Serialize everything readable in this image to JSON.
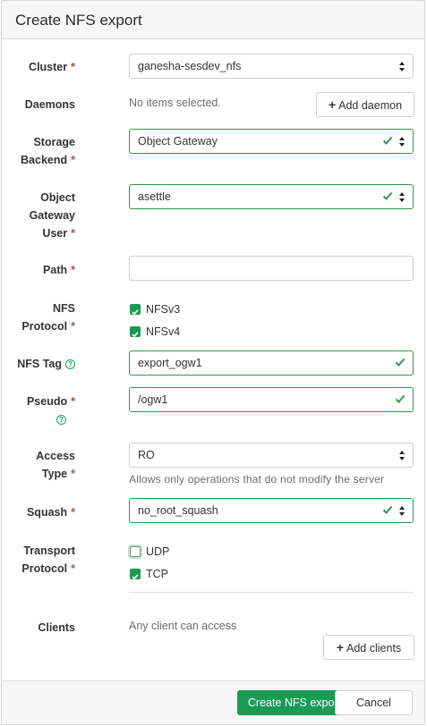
{
  "dialog": {
    "title": "Create NFS export"
  },
  "colors": {
    "primary": "#1a9b55",
    "valid_border": "#2c9a4f",
    "required": "#b94a48"
  },
  "form": {
    "cluster": {
      "label": "Cluster",
      "required_mark": "*",
      "value": "ganesha-sesdev_nfs"
    },
    "daemons": {
      "label": "Daemons",
      "empty_text": "No items selected.",
      "add_button": "Add daemon"
    },
    "storage_backend": {
      "label_line1": "Storage",
      "label_line2": "Backend",
      "required_mark": "*",
      "value": "Object Gateway"
    },
    "rgw_user": {
      "label_line1": "Object",
      "label_line2": "Gateway",
      "label_line3": "User",
      "required_mark": "*",
      "value": "asettle"
    },
    "path": {
      "label": "Path",
      "required_mark": "*",
      "value": ""
    },
    "nfs_protocol": {
      "label_line1": "NFS",
      "label_line2": "Protocol",
      "required_mark": "*",
      "options": [
        {
          "label": "NFSv3",
          "checked": true
        },
        {
          "label": "NFSv4",
          "checked": true
        }
      ]
    },
    "nfs_tag": {
      "label": "NFS Tag",
      "help_icon": "question-circle-icon",
      "help_glyph": "?",
      "value": "export_ogw1"
    },
    "pseudo": {
      "label": "Pseudo",
      "required_mark": "*",
      "help_icon": "question-circle-icon",
      "help_glyph": "?",
      "value": "/ogw1"
    },
    "access_type": {
      "label_line1": "Access",
      "label_line2": "Type",
      "required_mark": "*",
      "value": "RO",
      "hint": "Allows only operations that do not modify the server"
    },
    "squash": {
      "label": "Squash",
      "required_mark": "*",
      "value": "no_root_squash"
    },
    "transport_protocol": {
      "label_line1": "Transport",
      "label_line2": "Protocol",
      "required_mark": "*",
      "options": [
        {
          "label": "UDP",
          "checked": false
        },
        {
          "label": "TCP",
          "checked": true
        }
      ]
    },
    "clients": {
      "label": "Clients",
      "empty_text": "Any client can access",
      "add_button": "Add clients"
    }
  },
  "footer": {
    "submit": "Create NFS export",
    "cancel": "Cancel"
  },
  "icons": {
    "plus": "+",
    "select_arrows": "sort-icon",
    "valid": "check-icon"
  }
}
